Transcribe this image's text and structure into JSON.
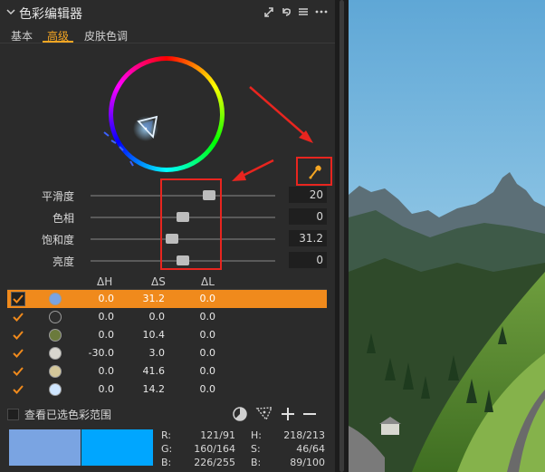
{
  "title": "色彩编辑器",
  "tabs": [
    {
      "label": "基本",
      "active": false
    },
    {
      "label": "高级",
      "active": true
    },
    {
      "label": "皮肤色调",
      "active": false
    }
  ],
  "sliders": [
    {
      "label": "平滑度",
      "value": "20",
      "position": 0.645
    },
    {
      "label": "色相",
      "value": "0",
      "position": 0.5
    },
    {
      "label": "饱和度",
      "value": "31.2",
      "position": 0.44
    },
    {
      "label": "亮度",
      "value": "0",
      "position": 0.5
    }
  ],
  "table": {
    "headers": [
      "ΔH",
      "ΔS",
      "ΔL"
    ],
    "rows": [
      {
        "checked": true,
        "selected": true,
        "swatch": "#7aa4e2",
        "dh": "0.0",
        "ds": "31.2",
        "dl": "0.0"
      },
      {
        "checked": true,
        "selected": false,
        "swatch": "#2e2e2e",
        "dh": "0.0",
        "ds": "0.0",
        "dl": "0.0"
      },
      {
        "checked": true,
        "selected": false,
        "swatch": "#6b7a3c",
        "dh": "0.0",
        "ds": "10.4",
        "dl": "0.0"
      },
      {
        "checked": true,
        "selected": false,
        "swatch": "#d8d6cf",
        "dh": "-30.0",
        "ds": "3.0",
        "dl": "0.0"
      },
      {
        "checked": true,
        "selected": false,
        "swatch": "#d4c79a",
        "dh": "0.0",
        "ds": "41.6",
        "dl": "0.0"
      },
      {
        "checked": true,
        "selected": false,
        "swatch": "#cfe6ff",
        "dh": "0.0",
        "ds": "14.2",
        "dl": "0.0"
      }
    ]
  },
  "bottom": {
    "view_label": "查看已选色彩范围"
  },
  "readout": {
    "r_label": "R:",
    "r_value": "121/91",
    "g_label": "G:",
    "g_value": "160/164",
    "b_label": "B:",
    "b_value": "226/255",
    "h_label": "H:",
    "h_value": "218/213",
    "s_label": "S:",
    "s_value": "46/64",
    "b2_label": "B:",
    "b2_value": "89/100"
  },
  "colors": {
    "accent": "#f5a623",
    "selected_row": "#f08a1c",
    "annotation": "#e8251f",
    "before_swatch": "#7aa4e2",
    "after_swatch": "#00a6ff"
  }
}
